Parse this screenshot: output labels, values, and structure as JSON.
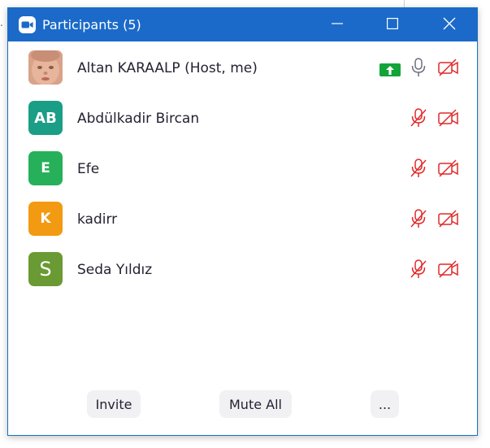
{
  "window": {
    "title": "Participants (5)",
    "app_icon": "zoom-camera-icon",
    "controls": [
      "minimize-icon",
      "maximize-icon",
      "close-icon"
    ]
  },
  "background": {
    "edge_text": "."
  },
  "participants": [
    {
      "name": "Altan KARAALP (Host, me)",
      "avatar_type": "photo",
      "initials": "",
      "avatar_color": "#d7a68e",
      "sharing": true,
      "mic": "unmuted",
      "video": "off"
    },
    {
      "name": "Abdülkadir Bircan",
      "avatar_type": "initials",
      "initials": "AB",
      "avatar_color": "#1b9e86",
      "sharing": false,
      "mic": "muted",
      "video": "off"
    },
    {
      "name": "Efe",
      "avatar_type": "initials",
      "initials": "E",
      "avatar_color": "#26b05a",
      "sharing": false,
      "mic": "muted",
      "video": "off"
    },
    {
      "name": "kadirr",
      "avatar_type": "initials",
      "initials": "K",
      "avatar_color": "#f29a12",
      "sharing": false,
      "mic": "muted",
      "video": "off"
    },
    {
      "name": "Seda Yıldız",
      "avatar_type": "initials",
      "initials": "S",
      "avatar_color": "#6a9a33",
      "sharing": false,
      "mic": "muted",
      "video": "off"
    }
  ],
  "footer": {
    "invite_label": "Invite",
    "mute_all_label": "Mute All",
    "more_label": "..."
  },
  "colors": {
    "titlebar": "#1b6ac9",
    "muted_red": "#e02828",
    "mic_gray": "#6e6e7e",
    "share_green": "#12a439",
    "button_bg": "#f1f1f4"
  }
}
